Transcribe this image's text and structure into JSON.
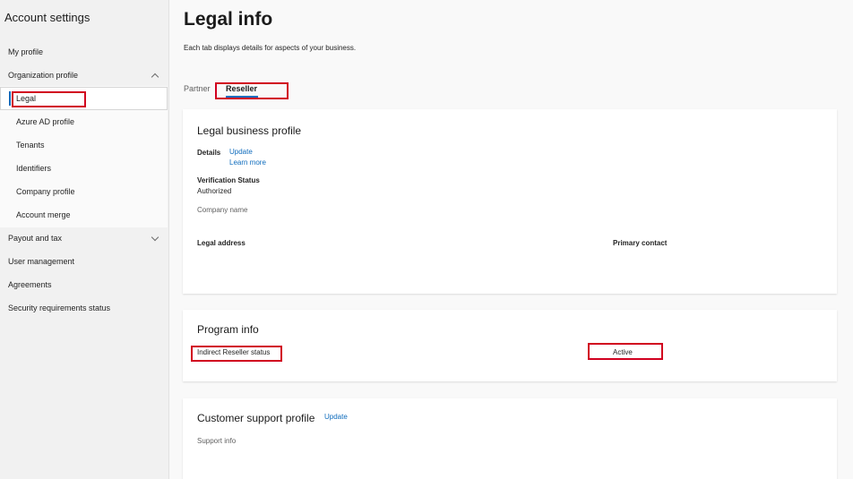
{
  "sidebar": {
    "title": "Account settings",
    "items": {
      "my_profile": "My profile",
      "organization_profile": "Organization profile",
      "legal": "Legal",
      "azure_ad_profile": "Azure AD profile",
      "tenants": "Tenants",
      "identifiers": "Identifiers",
      "company_profile": "Company profile",
      "account_merge": "Account merge",
      "payout_and_tax": "Payout and tax",
      "user_management": "User management",
      "agreements": "Agreements",
      "security_requirements_status": "Security requirements status"
    }
  },
  "main": {
    "title": "Legal info",
    "description": "Each tab displays details for aspects of your business.",
    "tabs": {
      "partner": "Partner",
      "reseller": "Reseller"
    },
    "legal_business_profile": {
      "title": "Legal business profile",
      "details_label": "Details",
      "update_link": "Update",
      "learn_more_link": "Learn more",
      "verification_status_label": "Verification Status",
      "verification_status_value": "Authorized",
      "company_name_label": "Company name",
      "legal_address_label": "Legal address",
      "primary_contact_label": "Primary contact"
    },
    "program_info": {
      "title": "Program info",
      "indirect_reseller_label": "Indirect Reseller status",
      "indirect_reseller_value": "Active"
    },
    "customer_support_profile": {
      "title": "Customer support profile",
      "update_link": "Update",
      "support_info_label": "Support info"
    }
  },
  "colors": {
    "accent": "#0f6cbd",
    "highlight": "#d1001f",
    "sidebar_bg": "#f1f1f1"
  }
}
